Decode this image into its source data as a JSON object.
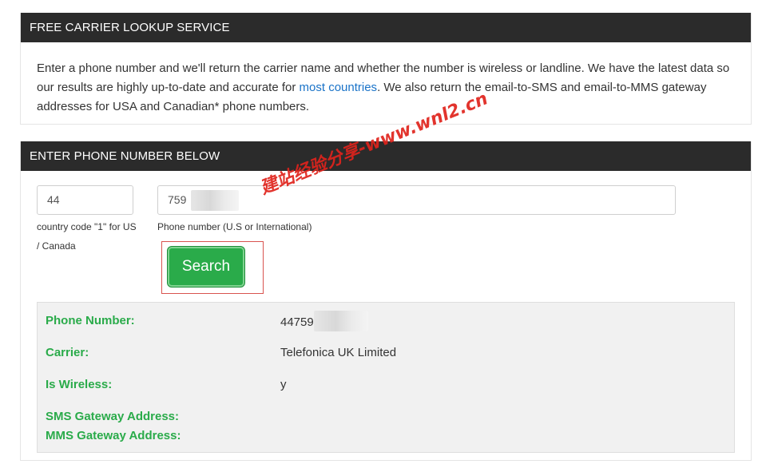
{
  "panel1": {
    "header": "FREE CARRIER LOOKUP SERVICE",
    "intro_part1": "Enter a phone number and we'll return the carrier name and whether the number is wireless or landline. We have the latest data so our results are highly up-to-date and accurate for ",
    "intro_link": "most countries",
    "intro_part2": ". We also return the email-to-SMS and email-to-MMS gateway addresses for USA and Canadian* phone numbers."
  },
  "panel2": {
    "header": "ENTER PHONE NUMBER BELOW",
    "country_code_value": "44",
    "country_code_hint": "country code \"1\" for US / Canada",
    "phone_value": "759",
    "phone_hint": "Phone number (U.S or International)",
    "search_label": "Search"
  },
  "result": {
    "phone_label": "Phone Number:",
    "phone_value": "44759",
    "carrier_label": "Carrier:",
    "carrier_value": "Telefonica UK Limited",
    "wireless_label": "Is Wireless:",
    "wireless_value": "y",
    "sms_label": "SMS Gateway Address:",
    "mms_label": "MMS Gateway Address:"
  },
  "watermark": "建站经验分享-www.wnl2.cn",
  "colors": {
    "header_bg": "#2b2b2b",
    "accent_green": "#2aab4a",
    "link_blue": "#1a73c8",
    "highlight_red": "#d9534f"
  }
}
